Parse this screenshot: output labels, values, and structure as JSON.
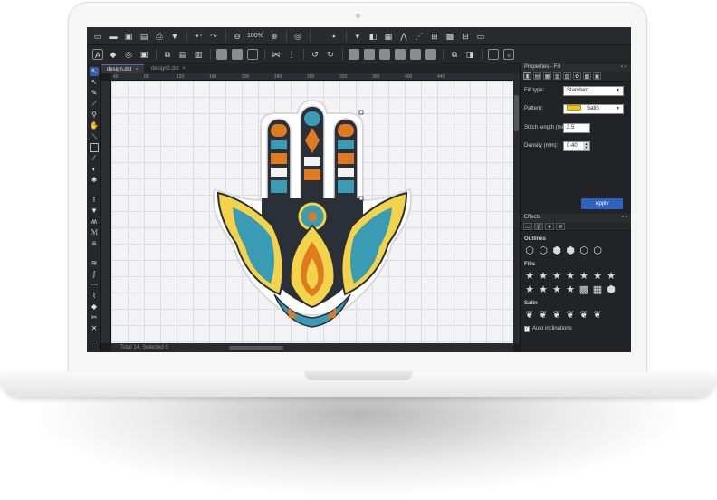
{
  "editor": {
    "zoom": "100%",
    "tabs": [
      {
        "label": "design.dst",
        "active": true
      },
      {
        "label": "design2.dst",
        "active": false
      }
    ],
    "status": "Total 14, Selected 0",
    "ruler_top": [
      "40",
      "80",
      "120",
      "160",
      "200",
      "240",
      "280",
      "320",
      "360",
      "400",
      "440"
    ]
  },
  "properties": {
    "title": "Properties - Fill",
    "fill_type_label": "Fill type:",
    "fill_type_value": "Standard",
    "pattern_label": "Pattern:",
    "pattern_value": "Satin",
    "stitch_length_label": "Stitch length (mm):",
    "stitch_length_value": "3.5",
    "density_label": "Density (mm):",
    "density_value": "0.40",
    "apply_label": "Apply"
  },
  "effects": {
    "title": "Effects",
    "outlines_label": "Outlines",
    "fills_label": "Fills",
    "satin_label": "Satin",
    "auto_inclinations_label": "Auto inclinations",
    "auto_inclinations_checked": true
  },
  "colors": {
    "accent": "#2f62c0",
    "design_orange": "#e07a1e",
    "design_teal": "#3a9bb5",
    "design_yellow": "#f2d34a",
    "design_dark": "#2a2f38"
  }
}
